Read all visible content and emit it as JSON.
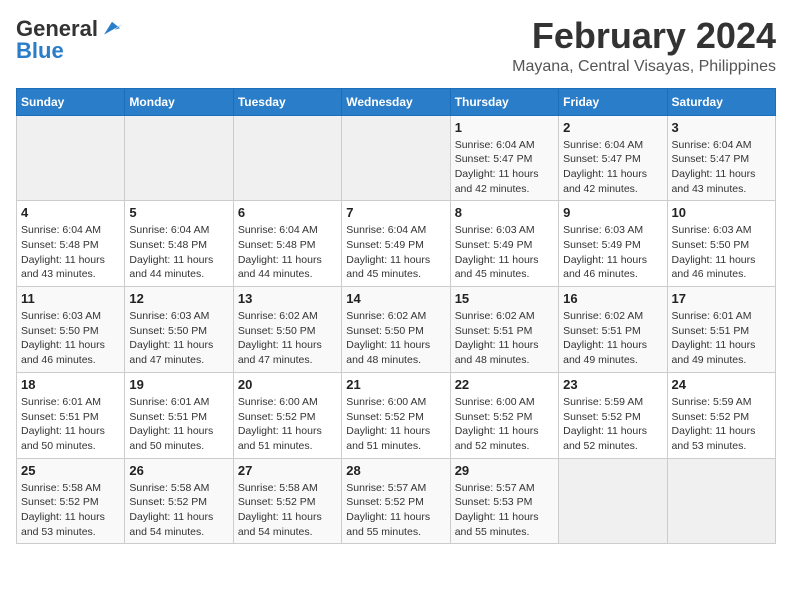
{
  "header": {
    "logo_general": "General",
    "logo_blue": "Blue",
    "title": "February 2024",
    "subtitle": "Mayana, Central Visayas, Philippines"
  },
  "calendar": {
    "days_of_week": [
      "Sunday",
      "Monday",
      "Tuesday",
      "Wednesday",
      "Thursday",
      "Friday",
      "Saturday"
    ],
    "weeks": [
      [
        {
          "day": "",
          "info": ""
        },
        {
          "day": "",
          "info": ""
        },
        {
          "day": "",
          "info": ""
        },
        {
          "day": "",
          "info": ""
        },
        {
          "day": "1",
          "info": "Sunrise: 6:04 AM\nSunset: 5:47 PM\nDaylight: 11 hours\nand 42 minutes."
        },
        {
          "day": "2",
          "info": "Sunrise: 6:04 AM\nSunset: 5:47 PM\nDaylight: 11 hours\nand 42 minutes."
        },
        {
          "day": "3",
          "info": "Sunrise: 6:04 AM\nSunset: 5:47 PM\nDaylight: 11 hours\nand 43 minutes."
        }
      ],
      [
        {
          "day": "4",
          "info": "Sunrise: 6:04 AM\nSunset: 5:48 PM\nDaylight: 11 hours\nand 43 minutes."
        },
        {
          "day": "5",
          "info": "Sunrise: 6:04 AM\nSunset: 5:48 PM\nDaylight: 11 hours\nand 44 minutes."
        },
        {
          "day": "6",
          "info": "Sunrise: 6:04 AM\nSunset: 5:48 PM\nDaylight: 11 hours\nand 44 minutes."
        },
        {
          "day": "7",
          "info": "Sunrise: 6:04 AM\nSunset: 5:49 PM\nDaylight: 11 hours\nand 45 minutes."
        },
        {
          "day": "8",
          "info": "Sunrise: 6:03 AM\nSunset: 5:49 PM\nDaylight: 11 hours\nand 45 minutes."
        },
        {
          "day": "9",
          "info": "Sunrise: 6:03 AM\nSunset: 5:49 PM\nDaylight: 11 hours\nand 46 minutes."
        },
        {
          "day": "10",
          "info": "Sunrise: 6:03 AM\nSunset: 5:50 PM\nDaylight: 11 hours\nand 46 minutes."
        }
      ],
      [
        {
          "day": "11",
          "info": "Sunrise: 6:03 AM\nSunset: 5:50 PM\nDaylight: 11 hours\nand 46 minutes."
        },
        {
          "day": "12",
          "info": "Sunrise: 6:03 AM\nSunset: 5:50 PM\nDaylight: 11 hours\nand 47 minutes."
        },
        {
          "day": "13",
          "info": "Sunrise: 6:02 AM\nSunset: 5:50 PM\nDaylight: 11 hours\nand 47 minutes."
        },
        {
          "day": "14",
          "info": "Sunrise: 6:02 AM\nSunset: 5:50 PM\nDaylight: 11 hours\nand 48 minutes."
        },
        {
          "day": "15",
          "info": "Sunrise: 6:02 AM\nSunset: 5:51 PM\nDaylight: 11 hours\nand 48 minutes."
        },
        {
          "day": "16",
          "info": "Sunrise: 6:02 AM\nSunset: 5:51 PM\nDaylight: 11 hours\nand 49 minutes."
        },
        {
          "day": "17",
          "info": "Sunrise: 6:01 AM\nSunset: 5:51 PM\nDaylight: 11 hours\nand 49 minutes."
        }
      ],
      [
        {
          "day": "18",
          "info": "Sunrise: 6:01 AM\nSunset: 5:51 PM\nDaylight: 11 hours\nand 50 minutes."
        },
        {
          "day": "19",
          "info": "Sunrise: 6:01 AM\nSunset: 5:51 PM\nDaylight: 11 hours\nand 50 minutes."
        },
        {
          "day": "20",
          "info": "Sunrise: 6:00 AM\nSunset: 5:52 PM\nDaylight: 11 hours\nand 51 minutes."
        },
        {
          "day": "21",
          "info": "Sunrise: 6:00 AM\nSunset: 5:52 PM\nDaylight: 11 hours\nand 51 minutes."
        },
        {
          "day": "22",
          "info": "Sunrise: 6:00 AM\nSunset: 5:52 PM\nDaylight: 11 hours\nand 52 minutes."
        },
        {
          "day": "23",
          "info": "Sunrise: 5:59 AM\nSunset: 5:52 PM\nDaylight: 11 hours\nand 52 minutes."
        },
        {
          "day": "24",
          "info": "Sunrise: 5:59 AM\nSunset: 5:52 PM\nDaylight: 11 hours\nand 53 minutes."
        }
      ],
      [
        {
          "day": "25",
          "info": "Sunrise: 5:58 AM\nSunset: 5:52 PM\nDaylight: 11 hours\nand 53 minutes."
        },
        {
          "day": "26",
          "info": "Sunrise: 5:58 AM\nSunset: 5:52 PM\nDaylight: 11 hours\nand 54 minutes."
        },
        {
          "day": "27",
          "info": "Sunrise: 5:58 AM\nSunset: 5:52 PM\nDaylight: 11 hours\nand 54 minutes."
        },
        {
          "day": "28",
          "info": "Sunrise: 5:57 AM\nSunset: 5:52 PM\nDaylight: 11 hours\nand 55 minutes."
        },
        {
          "day": "29",
          "info": "Sunrise: 5:57 AM\nSunset: 5:53 PM\nDaylight: 11 hours\nand 55 minutes."
        },
        {
          "day": "",
          "info": ""
        },
        {
          "day": "",
          "info": ""
        }
      ]
    ]
  }
}
